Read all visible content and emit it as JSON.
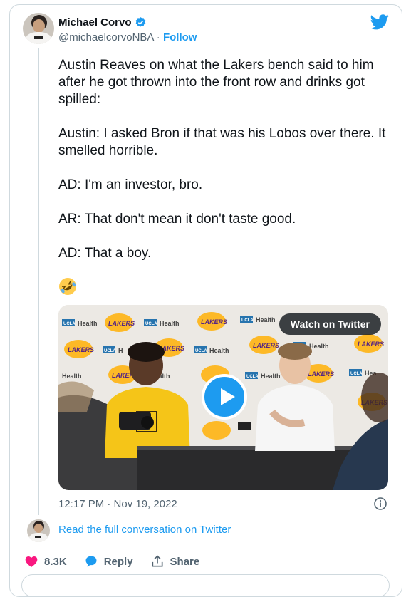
{
  "author": {
    "name": "Michael Corvo",
    "handle": "@michaelcorvoNBA",
    "separator": "·",
    "follow_label": "Follow"
  },
  "tweet": {
    "text": "Austin Reaves on what the Lakers bench said to him after he got thrown into the front row and drinks got spilled:\n\nAustin: I asked Bron if that was his Lobos over there. It smelled horrible.\n\nAD: I'm an investor, bro.\n\nAR: That don't mean it don't taste good.\n\nAD: That a boy.",
    "emoji": "rolling-on-floor-laughing",
    "media": {
      "watch_label": "Watch on Twitter",
      "backdrop_sponsor": "UCLA Health",
      "backdrop_team": "LAKERS"
    },
    "timestamp": "12:17 PM · Nov 19, 2022"
  },
  "read_more": "Read the full conversation on Twitter",
  "actions": {
    "likes": "8.3K",
    "reply_label": "Reply",
    "share_label": "Share"
  },
  "colors": {
    "accent": "#1d9bf0",
    "like": "#f91880",
    "muted": "#536471",
    "border": "#cfd9de",
    "lakers_gold": "#fdb927",
    "lakers_purple": "#552583"
  },
  "icons": [
    "verified-badge-icon",
    "twitter-bird-icon",
    "play-icon",
    "info-icon",
    "heart-icon",
    "reply-bubble-icon",
    "share-icon"
  ]
}
